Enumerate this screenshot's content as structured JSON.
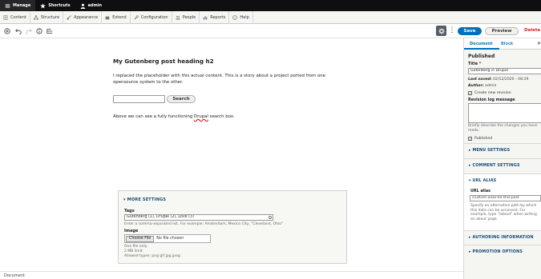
{
  "admin_bar": {
    "manage": "Manage",
    "shortcuts": "Shortcuts",
    "user": "admin"
  },
  "admin_menu": {
    "items": [
      "Content",
      "Structure",
      "Appearance",
      "Extend",
      "Configuration",
      "People",
      "Reports",
      "Help"
    ]
  },
  "editor_toolbar": {
    "save": "Save",
    "preview": "Preview",
    "delete": "Delete"
  },
  "content": {
    "heading": "My Gutenberg post heading h2",
    "paragraph": "I replaced the placeholder with this actual content. This is a story about a project ported from one opensource system to the other.",
    "search_button": "Search",
    "caption_before": "Above we can see a fully functioning ",
    "caption_word": "Drupal",
    "caption_after": " search box."
  },
  "more_settings": {
    "title": "MORE SETTINGS",
    "tags_label": "Tags",
    "tags_value": "Gutenberg (1), Drupal (2), Love (3)",
    "tags_help": "Enter a comma-separated list. For example: Amsterdam, Mexico City, \"Cleveland, Ohio\"",
    "image_label": "Image",
    "choose_file": "Choose File",
    "no_file": "No file chosen",
    "image_help_1": "One file only.",
    "image_help_2": "2 MB limit.",
    "image_help_3": "Allowed types: png gif jpg jpeg."
  },
  "footer": {
    "text": "Document"
  },
  "sidebar": {
    "tab_document": "Document",
    "tab_block": "Block",
    "close": "✕",
    "status": "Published",
    "title_label": "Title",
    "title_required": "*",
    "title_value": "Gutenberg in Drupal",
    "last_saved_label": "Last saved:",
    "last_saved_value": "02/12/2020 - 08:29",
    "author_label": "Author:",
    "author_value": "admin",
    "create_revision": "Create new revision",
    "revision_log_label": "Revision log message",
    "revision_help": "Briefly describe the changes you have made.",
    "published": "Published",
    "menu_settings": "MENU SETTINGS",
    "comment_settings": "COMMENT SETTINGS",
    "url_alias_section": "URL ALIAS",
    "url_alias_label": "URL alias",
    "url_alias_value": "/custom-alias-for-this-post",
    "url_alias_help": "Specify an alternative path by which this data can be accessed. For example, type \"/about\" when writing an about page.",
    "authoring_information": "AUTHORING INFORMATION",
    "promotion_options": "PROMOTION OPTIONS"
  },
  "colors": {
    "primary": "#0071b8",
    "danger": "#d72222",
    "admin_bar": "#0f0f0f",
    "section_label": "#0f4a7a"
  }
}
